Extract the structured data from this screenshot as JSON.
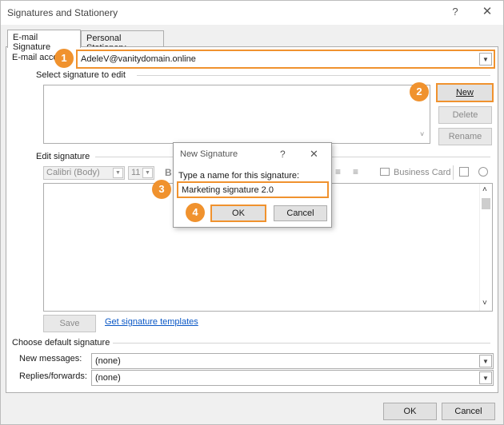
{
  "window": {
    "title": "Signatures and Stationery",
    "help_glyph": "?",
    "close_glyph": "✕"
  },
  "tabs": [
    {
      "label": "E-mail Signature",
      "active": true
    },
    {
      "label": "Personal Stationery",
      "active": false
    }
  ],
  "email_account": {
    "label": "E-mail acco",
    "value": "AdeleV@vanitydomain.online"
  },
  "select_signature": {
    "label": "Select signature to edit",
    "new_label": "New",
    "delete_label": "Delete",
    "rename_label": "Rename"
  },
  "edit_signature": {
    "label": "Edit signature",
    "font": "Calibri (Body)",
    "size": "11",
    "business_card_label": "Business Card",
    "save_label": "Save",
    "templates_link": "Get signature templates"
  },
  "defaults": {
    "heading": "Choose default signature",
    "new_messages_label": "New messages:",
    "new_messages_value": "(none)",
    "replies_label": "Replies/forwards:",
    "replies_value": "(none)"
  },
  "footer": {
    "ok_label": "OK",
    "cancel_label": "Cancel"
  },
  "new_signature_dialog": {
    "title": "New Signature",
    "help_glyph": "?",
    "close_glyph": "✕",
    "prompt": "Type a name for this signature:",
    "input_value": "Marketing signature 2.0",
    "ok_label": "OK",
    "cancel_label": "Cancel"
  },
  "step_badges": [
    "1",
    "2",
    "3",
    "4"
  ],
  "colors": {
    "highlight": "#f0922e",
    "link": "#0b58c6"
  }
}
